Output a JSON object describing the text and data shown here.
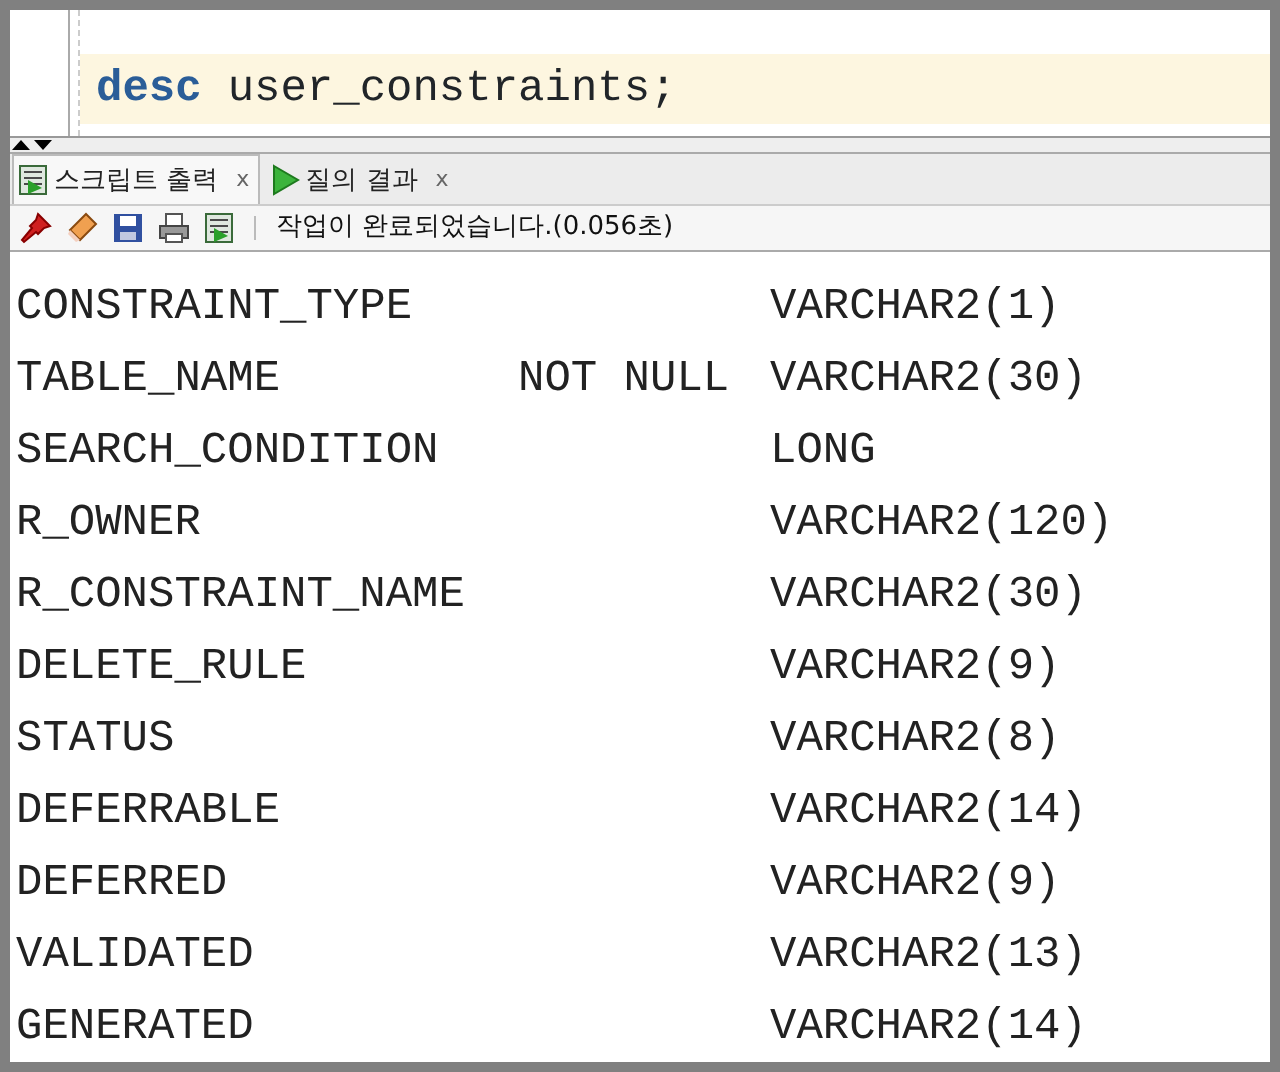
{
  "editor": {
    "current_line": true,
    "tokens": [
      {
        "kind": "keyword",
        "text": "desc"
      },
      {
        "kind": "plain",
        "text": "user_constraints;"
      }
    ]
  },
  "tabs": [
    {
      "label": "스크립트 출력",
      "kind": "script",
      "selected": true,
      "close": "x"
    },
    {
      "label": "질의 결과",
      "kind": "run",
      "selected": false,
      "close": "x"
    }
  ],
  "status": "작업이 완료되었습니다.(0.056초)",
  "rows": [
    {
      "name": "CONSTRAINT_TYPE",
      "type": "VARCHAR2(1)"
    },
    {
      "name": "TABLE_NAME",
      "null": "NOT NULL",
      "type": "VARCHAR2(30)"
    },
    {
      "name": "SEARCH_CONDITION",
      "type": "LONG"
    },
    {
      "name": "R_OWNER",
      "type": "VARCHAR2(120)"
    },
    {
      "name": "R_CONSTRAINT_NAME",
      "type": "VARCHAR2(30)"
    },
    {
      "name": "DELETE_RULE",
      "type": "VARCHAR2(9)"
    },
    {
      "name": "STATUS",
      "type": "VARCHAR2(8)"
    },
    {
      "name": "DEFERRABLE",
      "type": "VARCHAR2(14)"
    },
    {
      "name": "DEFERRED",
      "type": "VARCHAR2(9)"
    },
    {
      "name": "VALIDATED",
      "type": "VARCHAR2(13)"
    },
    {
      "name": "GENERATED",
      "type": "VARCHAR2(14)"
    }
  ]
}
